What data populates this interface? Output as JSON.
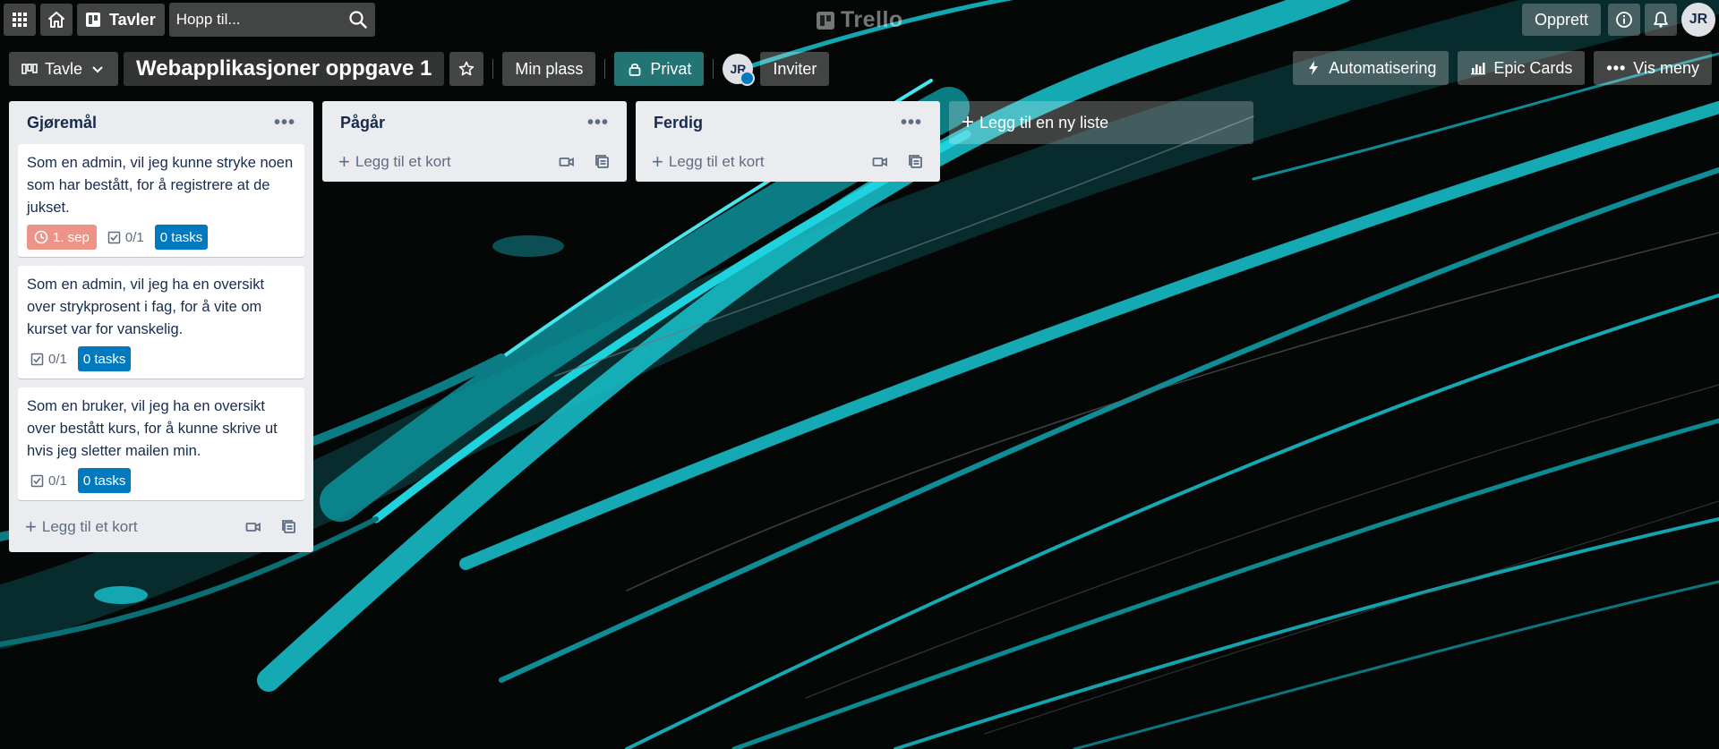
{
  "header": {
    "boards_label": "Tavler",
    "search_placeholder": "Hopp til...",
    "logo_text": "Trello",
    "create_label": "Opprett",
    "avatar_initials": "JR"
  },
  "board": {
    "view_label": "Tavle",
    "title": "Webapplikasjoner oppgave 1",
    "workspace_label": "Min plass",
    "visibility_label": "Privat",
    "member_initials": "JR",
    "invite_label": "Inviter",
    "automation_label": "Automatisering",
    "epic_cards_label": "Epic Cards",
    "menu_label": "Vis meny"
  },
  "lists": [
    {
      "title": "Gjøremål",
      "cards": [
        {
          "text": "Som en admin, vil jeg kunne stryke noen som har bestått, for å registrere at de jukset.",
          "due": "1. sep",
          "checklist": "0/1",
          "tasks": "0 tasks"
        },
        {
          "text": "Som en admin, vil jeg ha en oversikt over strykprosent i fag, for å vite om kurset var for vanskelig.",
          "checklist": "0/1",
          "tasks": "0 tasks"
        },
        {
          "text": "Som en bruker, vil jeg ha en oversikt over bestått kurs, for å kunne skrive ut hvis jeg sletter mailen min.",
          "checklist": "0/1",
          "tasks": "0 tasks"
        }
      ],
      "add_card_label": "Legg til et kort"
    },
    {
      "title": "Pågår",
      "cards": [],
      "add_card_label": "Legg til et kort"
    },
    {
      "title": "Ferdig",
      "cards": [],
      "add_card_label": "Legg til et kort"
    }
  ],
  "add_list_label": "Legg til en ny liste",
  "colors": {
    "background": "#050707",
    "accent_streaks": "#16b4be",
    "list_bg": "#ebecf0",
    "due_overdue": "#ec9488",
    "tasks_badge": "#0079bf"
  }
}
